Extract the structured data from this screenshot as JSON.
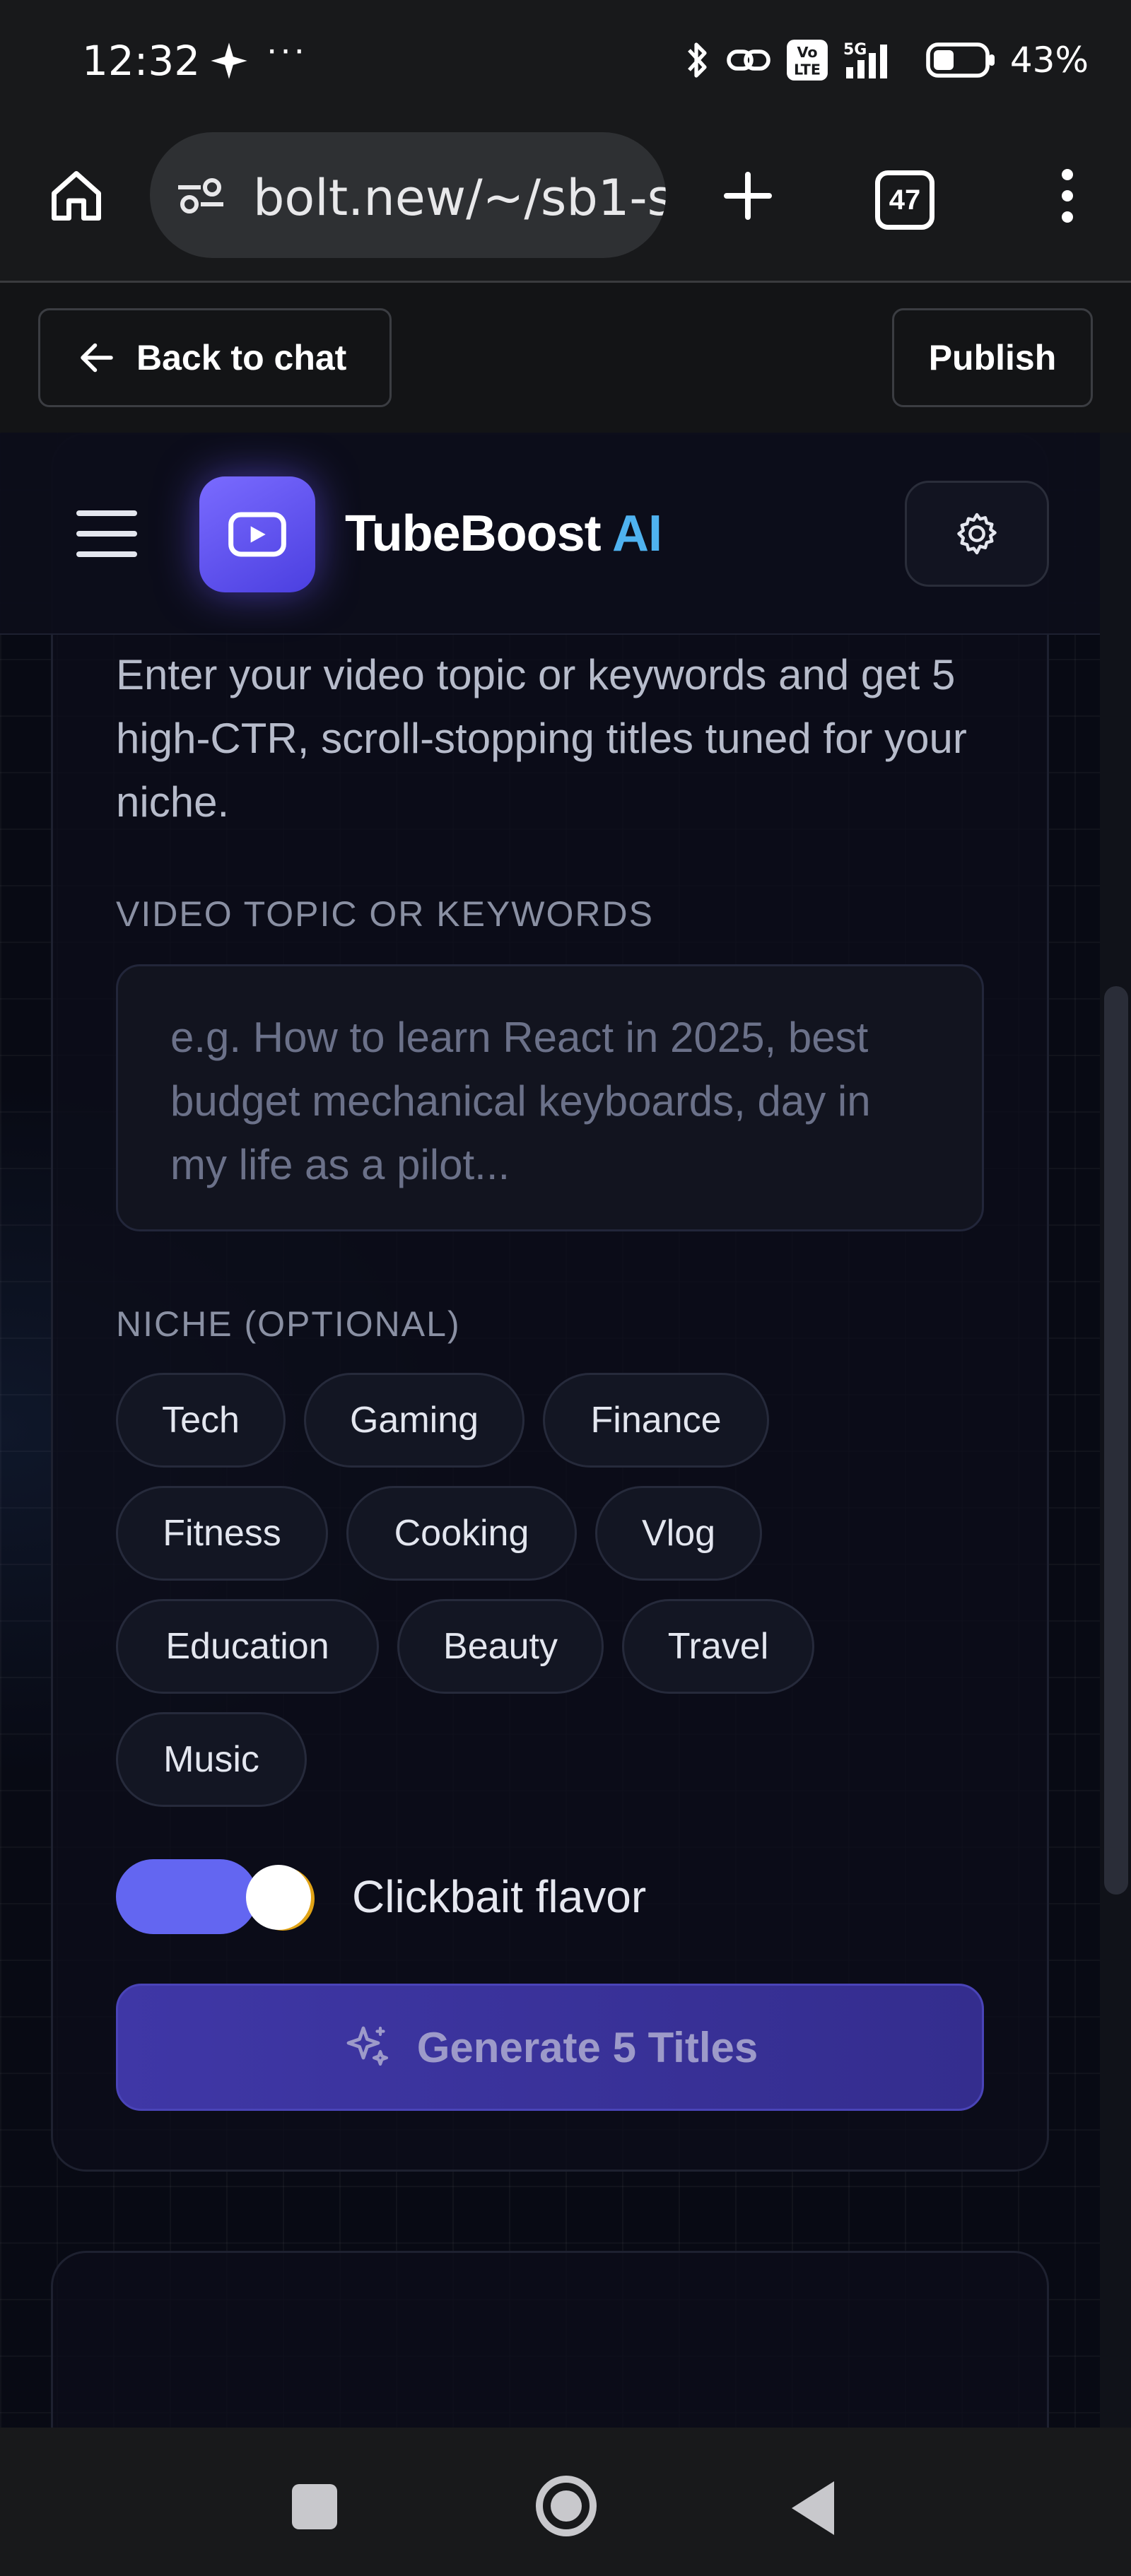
{
  "status_bar": {
    "time": "12:32",
    "dots": "···",
    "icons": [
      "spark-icon",
      "bluetooth-icon",
      "link-icon",
      "volte-icon",
      "signal-5g-icon",
      "battery-icon"
    ],
    "volte_label": "Vo\nLTE",
    "network_label": "5G",
    "battery_percent": "43%"
  },
  "browser": {
    "url": "bolt.new/~/sb1-s",
    "tab_count": "47"
  },
  "preview_bar": {
    "back_label": "Back to chat",
    "publish_label": "Publish"
  },
  "app": {
    "brand_main": "TubeBoost",
    "brand_accent": "AI",
    "description": "Enter your video topic or keywords and get 5 high-CTR, scroll-stopping titles tuned for your niche.",
    "topic_label": "VIDEO TOPIC OR KEYWORDS",
    "topic_placeholder": "e.g. How to learn React in 2025, best budget mechanical keyboards, day in my life as a pilot...",
    "niche_label": "NICHE (OPTIONAL)",
    "niches": [
      "Tech",
      "Gaming",
      "Finance",
      "Fitness",
      "Cooking",
      "Vlog",
      "Education",
      "Beauty",
      "Travel",
      "Music"
    ],
    "clickbait_label": "Clickbait flavor",
    "clickbait_enabled": true,
    "generate_label": "Generate 5 Titles"
  },
  "colors": {
    "accent": "#6366f1",
    "brand_ai": "#4fb2f0",
    "background": "#080a14"
  }
}
